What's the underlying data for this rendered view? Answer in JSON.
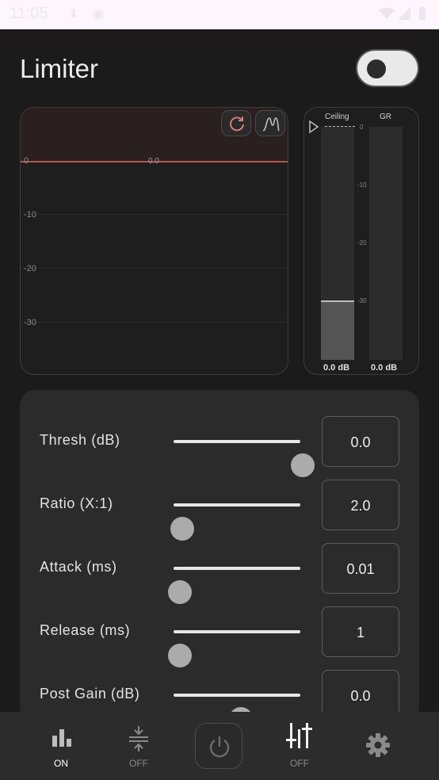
{
  "status_bar": {
    "time": "11:05"
  },
  "header": {
    "title": "Limiter",
    "enabled": false
  },
  "graph": {
    "y_labels": [
      "0",
      "-10",
      "-20",
      "-30"
    ],
    "threshold_label": "0.0",
    "buttons": [
      "reset-icon",
      "curve-icon"
    ]
  },
  "meters": {
    "ceiling_label": "Ceiling",
    "gr_label": "GR",
    "scale": [
      "0",
      "-10",
      "-20",
      "-30"
    ],
    "ceiling_value": "0.0 dB",
    "gr_value": "0.0 dB",
    "ceiling_level_db": -30,
    "gr_level_db": -40
  },
  "params": [
    {
      "label": "Thresh (dB)",
      "value": "0.0",
      "slider_fraction": 1.0
    },
    {
      "label": "Ratio (X:1)",
      "value": "2.0",
      "slider_fraction": 0.03
    },
    {
      "label": "Attack (ms)",
      "value": "0.01",
      "slider_fraction": 0.01
    },
    {
      "label": "Release (ms)",
      "value": "1",
      "slider_fraction": 0.01
    },
    {
      "label": "Post Gain (dB)",
      "value": "0.0",
      "slider_fraction": 0.5
    }
  ],
  "bottom_nav": {
    "eq": {
      "label": "ON",
      "icon": "bar-chart-icon"
    },
    "compressor": {
      "label": "OFF",
      "icon": "compress-icon"
    },
    "power": {
      "icon": "power-icon"
    },
    "mixer": {
      "label": "OFF",
      "icon": "sliders-icon"
    },
    "settings": {
      "icon": "gear-icon"
    }
  },
  "colors": {
    "accent": "#b85252",
    "background": "#1b1b1b",
    "panel": "#2b2b2b"
  }
}
